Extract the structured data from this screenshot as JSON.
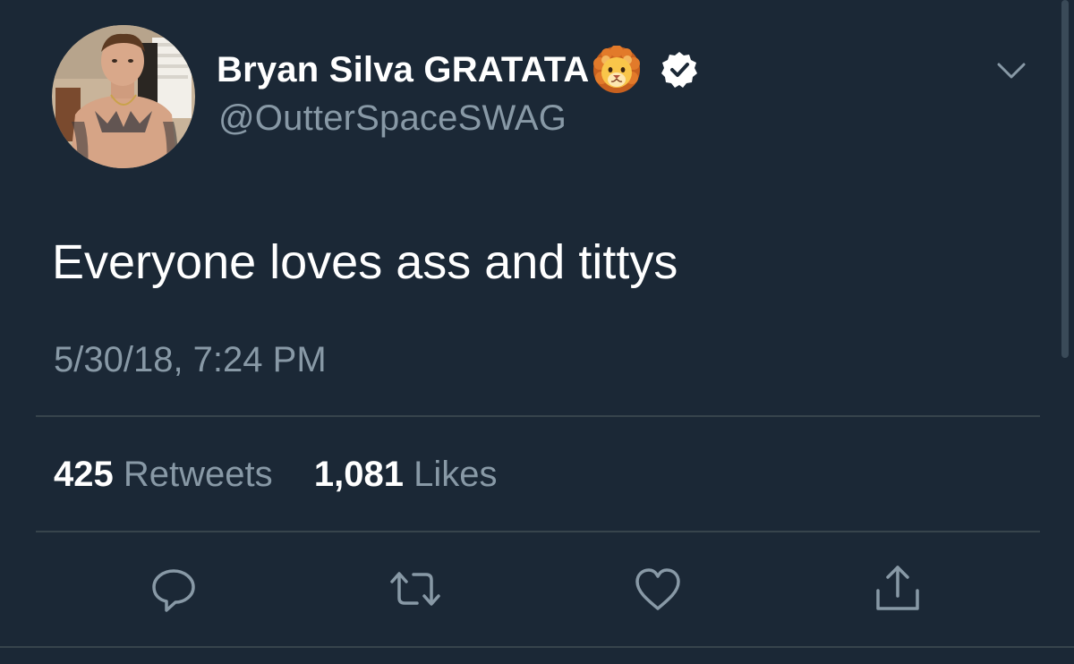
{
  "user": {
    "display_name": "Bryan Silva GRATATA",
    "handle": "@OutterSpaceSWAG",
    "name_emoji": "lion-face-icon",
    "verified": true
  },
  "tweet": {
    "text": "Everyone loves ass and tittys",
    "timestamp": "5/30/18, 7:24 PM"
  },
  "stats": {
    "retweets_count": "425",
    "retweets_label": "Retweets",
    "likes_count": "1,081",
    "likes_label": "Likes"
  },
  "actions": [
    "reply-icon",
    "retweet-icon",
    "like-icon",
    "share-icon"
  ],
  "colors": {
    "background": "#1b2836",
    "primary_text": "#ffffff",
    "secondary_text": "#8899a6",
    "divider": "#37444c"
  }
}
